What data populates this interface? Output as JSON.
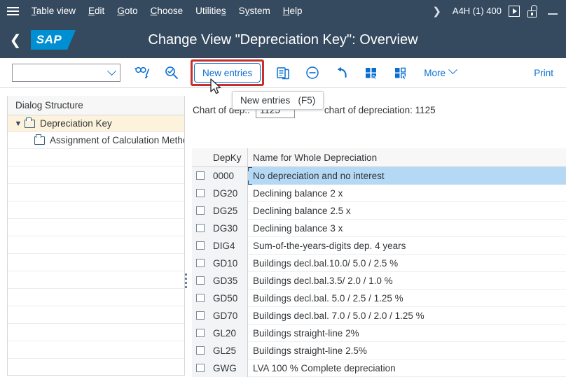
{
  "menubar": {
    "hamburger_icon": "hamburger-menu-icon",
    "items": [
      {
        "label": "Table view",
        "accel": "T"
      },
      {
        "label": "Edit",
        "accel": "E"
      },
      {
        "label": "Goto",
        "accel": "G"
      },
      {
        "label": "Choose",
        "accel": "C"
      },
      {
        "label": "Utilities",
        "accel": "s"
      },
      {
        "label": "System",
        "accel": "y"
      },
      {
        "label": "Help",
        "accel": "H"
      }
    ],
    "overflow_icon": "chevron-right-icon",
    "system_info": "A4H (1) 400",
    "play_icon": "run-transaction-icon",
    "lock_icon": "unlocked-session-icon",
    "minimize_icon": "minimize-icon"
  },
  "shellbar": {
    "back_icon": "back-navigation-icon",
    "logo_text": "SAP",
    "title": "Change View \"Depreciation Key\": Overview"
  },
  "toolbar": {
    "combo_value": "",
    "combo_placeholder": "",
    "display_change_icon": "display-change-toggle-icon",
    "search_icon": "position-search-icon",
    "new_entries_label": "New entries",
    "copy_icon": "copy-as-icon",
    "delete_icon": "delete-row-icon",
    "undo_icon": "undo-change-icon",
    "select_all_icon": "select-all-icon",
    "deselect_all_icon": "deselect-all-icon",
    "more_label": "More",
    "more_chevron_icon": "chevron-down-icon",
    "print_label": "Print",
    "highlight_color": "#c9302c"
  },
  "tooltip": {
    "text": "New entries   (F5)"
  },
  "chart_row": {
    "label": "Chart of dep.:",
    "value": "1125",
    "suffix": "chart of depreciation: 1125"
  },
  "dialog_structure": {
    "header": "Dialog Structure",
    "nodes": [
      {
        "label": "Depreciation Key",
        "selected": true,
        "expanded": true,
        "icon": "folder-open-icon"
      },
      {
        "label": "Assignment of Calculation Metho",
        "selected": false,
        "expanded": false,
        "icon": "folder-icon"
      }
    ],
    "empty_row_count": 13
  },
  "splitter": {
    "name": "panel-splitter-handle"
  },
  "table": {
    "columns": [
      {
        "key": "checkbox",
        "label": ""
      },
      {
        "key": "depky",
        "label": "DepKy"
      },
      {
        "key": "name",
        "label": "Name for Whole Depreciation"
      }
    ],
    "selected_row_index": 0,
    "rows": [
      {
        "depky": "0000",
        "name": "No depreciation and no interest",
        "checked": false
      },
      {
        "depky": "DG20",
        "name": "Declining balance 2 x",
        "checked": false
      },
      {
        "depky": "DG25",
        "name": "Declining balance 2.5 x",
        "checked": false
      },
      {
        "depky": "DG30",
        "name": "Declining balance 3 x",
        "checked": false
      },
      {
        "depky": "DIG4",
        "name": "Sum-of-the-years-digits dep. 4 years",
        "checked": false
      },
      {
        "depky": "GD10",
        "name": "Buildings decl.bal.10.0/ 5.0 / 2.5 %",
        "checked": false
      },
      {
        "depky": "GD35",
        "name": "Buildings decl.bal.3.5/ 2.0 / 1.0  %",
        "checked": false
      },
      {
        "depky": "GD50",
        "name": "Buildings decl.bal. 5.0 / 2.5 / 1.25 %",
        "checked": false
      },
      {
        "depky": "GD70",
        "name": "Buildings decl.bal. 7.0 / 5.0 / 2.0 / 1.25 %",
        "checked": false
      },
      {
        "depky": "GL20",
        "name": "Buildings straight-line 2%",
        "checked": false
      },
      {
        "depky": "GL25",
        "name": "Buildings straight-line 2.5%",
        "checked": false
      },
      {
        "depky": "GWG",
        "name": "LVA 100 % Complete depreciation",
        "checked": false
      }
    ]
  },
  "cursor": {
    "name": "mouse-pointer"
  },
  "colors": {
    "shell_bg": "#354a5f",
    "accent_blue": "#0a6ed1",
    "logo_blue": "#008fd3",
    "row_selected": "#b5d9f5",
    "tree_selected": "#fdf3dc",
    "highlight_red": "#c9302c"
  }
}
